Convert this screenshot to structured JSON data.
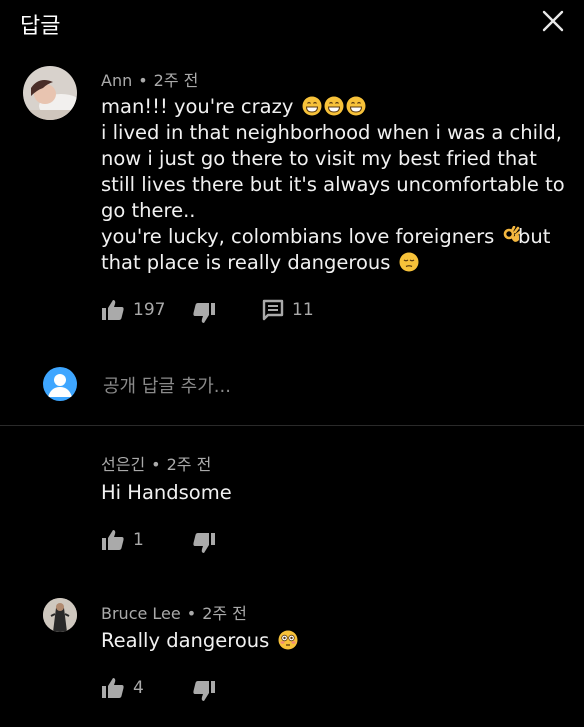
{
  "header": {
    "title": "답글"
  },
  "icons": {
    "close": "close-icon",
    "like": "thumbs-up-icon",
    "dislike": "thumbs-down-icon",
    "reply": "reply-icon"
  },
  "comment": {
    "author": "Ann",
    "time": "2주 전",
    "lines": [
      "man!!! you're crazy",
      "i lived in that neighborhood when i was a child,",
      "now i just go there to visit my best fried that",
      "still lives there but it's always uncomfortable to",
      "go there..",
      "you're lucky, colombians love foreigners",
      "that place is really dangerous"
    ],
    "likes": "197",
    "replies": "11"
  },
  "reply_input": {
    "placeholder": "공개 답글 추가..."
  },
  "replies": [
    {
      "author": "선은긴",
      "time": "2주 전",
      "text": "Hi Handsome",
      "likes": "1"
    },
    {
      "author": "Bruce Lee",
      "time": "2주 전",
      "text": "Really dangerous",
      "likes": "4"
    }
  ],
  "colors": {
    "background": "#000000",
    "text": "#f1f1f1",
    "secondary_text": "#aaaaaa",
    "user_avatar": "#3ea6ff"
  }
}
